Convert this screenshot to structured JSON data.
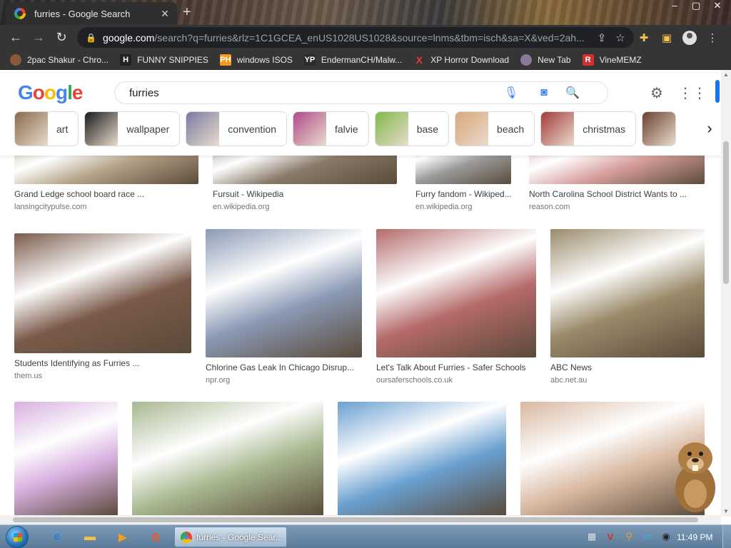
{
  "browser": {
    "tab_title": "furries - Google Search",
    "tab_close": "✕",
    "new_tab": "+",
    "window_controls": [
      "–",
      "▢",
      "✕"
    ],
    "url_host": "google.com",
    "url_path": "/search?q=furries&rlz=1C1GCEA_enUS1028US1028&source=lnms&tbm=isch&sa=X&ved=2ah...",
    "bookmarks": [
      {
        "label": "2pac Shakur - Chro...",
        "icon": "avatar-icon",
        "color": "#8b5a3c",
        "glyph": ""
      },
      {
        "label": "FUNNY SNIPPIES",
        "icon": "h-icon",
        "color": "#222222",
        "glyph": "H"
      },
      {
        "label": "windows ISOS",
        "icon": "ph-icon",
        "color": "#f7971d",
        "glyph": "PH"
      },
      {
        "label": "EndermanCH/Malw...",
        "icon": "yp-icon",
        "color": "#2b2b2b",
        "glyph": "YP"
      },
      {
        "label": "XP Horror Download",
        "icon": "x-icon",
        "color": "#353535",
        "glyph": "X"
      },
      {
        "label": "New Tab",
        "icon": "globe-icon",
        "color": "#8a7a9a",
        "glyph": ""
      },
      {
        "label": "VineMEMZ",
        "icon": "r-icon",
        "color": "#d32f2f",
        "glyph": "R"
      }
    ]
  },
  "google": {
    "logo_letters": [
      {
        "ch": "G",
        "color": "#4285f4"
      },
      {
        "ch": "o",
        "color": "#ea4335"
      },
      {
        "ch": "o",
        "color": "#fbbc05"
      },
      {
        "ch": "g",
        "color": "#4285f4"
      },
      {
        "ch": "l",
        "color": "#34a853"
      },
      {
        "ch": "e",
        "color": "#ea4335"
      }
    ],
    "query": "furries",
    "chips": [
      {
        "label": "art",
        "thumb": "#8a6a4a"
      },
      {
        "label": "wallpaper",
        "thumb": "#1a1a1a"
      },
      {
        "label": "convention",
        "thumb": "#7a7aa0"
      },
      {
        "label": "falvie",
        "thumb": "#b04a8a"
      },
      {
        "label": "base",
        "thumb": "#7fb84a"
      },
      {
        "label": "beach",
        "thumb": "#d9a77a"
      },
      {
        "label": "christmas",
        "thumb": "#a33a3a"
      },
      {
        "label": "",
        "thumb": "#6a4030"
      }
    ]
  },
  "results": [
    {
      "title": "Grand Ledge school board race ...",
      "source": "lansingcitypulse.com",
      "color": "#b5a48a"
    },
    {
      "title": "Fursuit - Wikipedia",
      "source": "en.wikipedia.org",
      "color": "#8a7a6a"
    },
    {
      "title": "Furry fandom - Wikiped...",
      "source": "en.wikipedia.org",
      "color": "#9a9a9a"
    },
    {
      "title": "North Carolina School District Wants to ...",
      "source": "reason.com",
      "color": "#d9a0a0"
    },
    {
      "title": "Students Identifying as Furries ...",
      "source": "them.us",
      "color": "#7a5a4a"
    },
    {
      "title": "Chlorine Gas Leak In Chicago Disrup...",
      "source": "npr.org",
      "color": "#8a9ab5"
    },
    {
      "title": "Let's Talk About Furries - Safer Schools",
      "source": "oursaferschools.co.uk",
      "color": "#b56a6a"
    },
    {
      "title": "ABC News",
      "source": "abc.net.au",
      "color": "#9a8a6a"
    },
    {
      "title": "",
      "source": "",
      "color": "#d8b0e0"
    },
    {
      "title": "",
      "source": "",
      "color": "#a8b890"
    },
    {
      "title": "",
      "source": "",
      "color": "#6aa0d0"
    },
    {
      "title": "",
      "source": "",
      "color": "#d8b8a0"
    }
  ],
  "taskbar": {
    "task_label": "furries - Google Sear...",
    "clock": "11:49 PM"
  }
}
